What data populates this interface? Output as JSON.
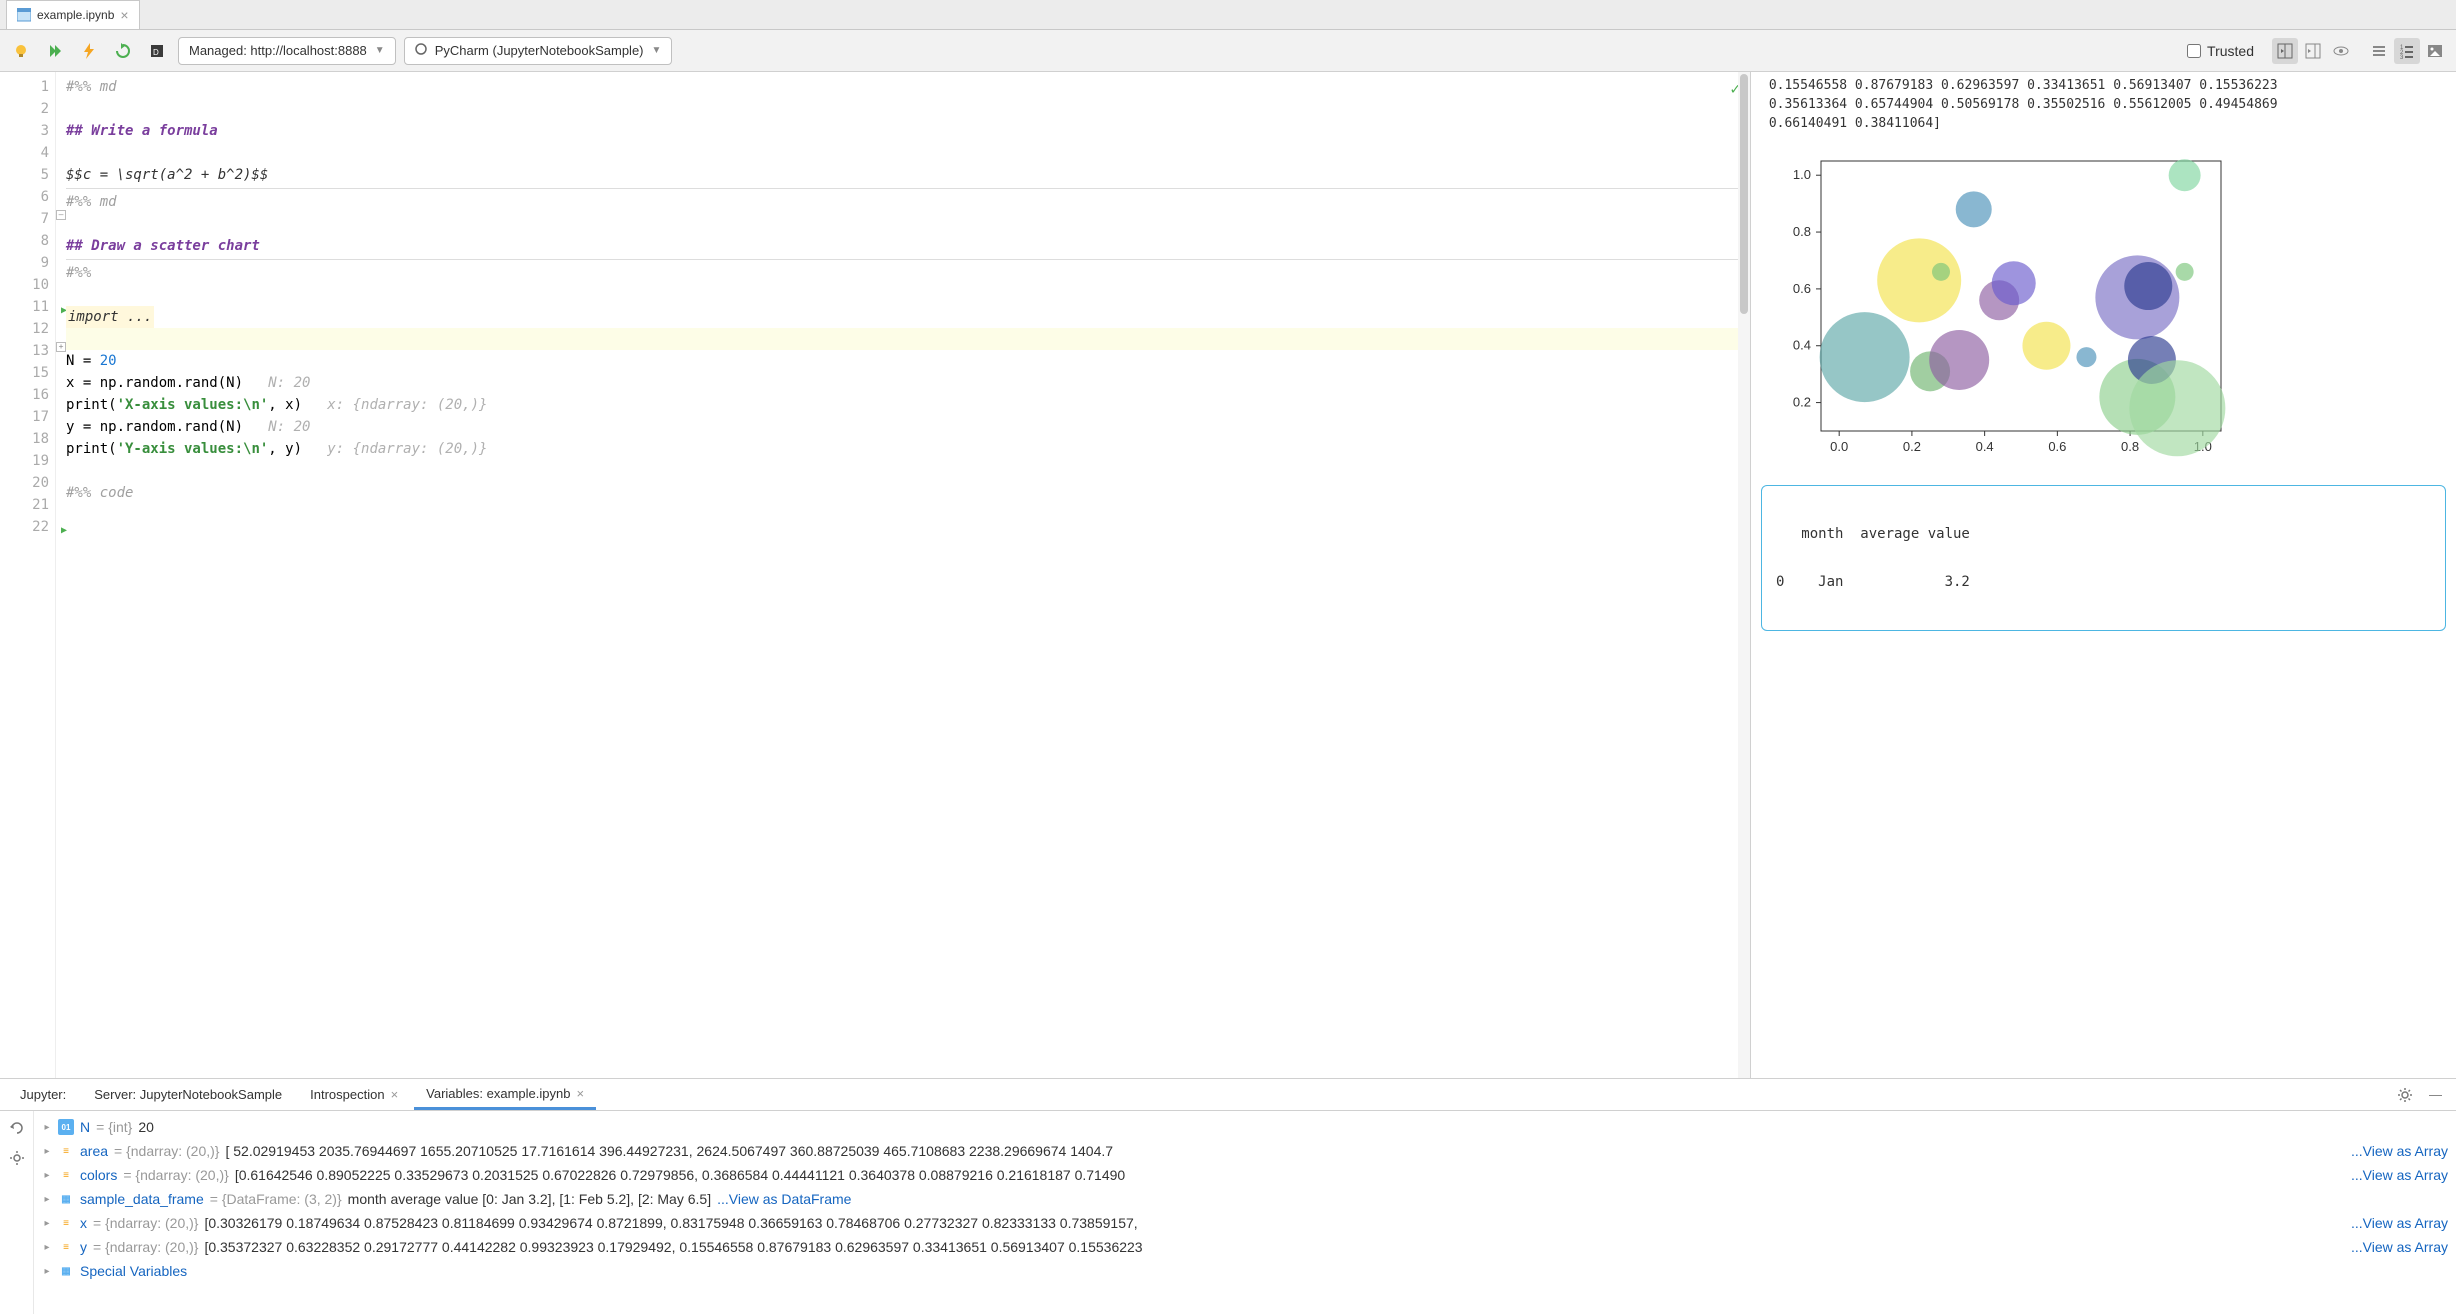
{
  "tab": {
    "filename": "example.ipynb"
  },
  "toolbar": {
    "server_dropdown": "Managed: http://localhost:8888",
    "kernel_dropdown": "PyCharm (JupyterNotebookSample)",
    "trusted_label": "Trusted",
    "trusted_checked": false
  },
  "editor": {
    "lines": [
      {
        "n": "1",
        "type": "comment",
        "text": "#%% md"
      },
      {
        "n": "2",
        "type": "blank",
        "text": ""
      },
      {
        "n": "3",
        "type": "heading",
        "text": "## Write a formula"
      },
      {
        "n": "4",
        "type": "blank",
        "text": ""
      },
      {
        "n": "5",
        "type": "raw",
        "text": "$$c = \\sqrt(a^2 + b^2)$$"
      },
      {
        "n": "6",
        "type": "hr",
        "text": ""
      },
      {
        "n": "7",
        "type": "comment",
        "text": "#%% md"
      },
      {
        "n": "8",
        "type": "blank",
        "text": ""
      },
      {
        "n": "9",
        "type": "heading",
        "text": "## Draw a scatter chart"
      },
      {
        "n": "10",
        "type": "hr",
        "text": ""
      },
      {
        "n": "11",
        "type": "comment",
        "text": "#%%",
        "run": true
      },
      {
        "n": "12",
        "type": "blank",
        "text": ""
      },
      {
        "n": "13",
        "type": "import",
        "text": "import ..."
      },
      {
        "n": "15",
        "type": "blank",
        "text": "",
        "highlight": true
      },
      {
        "n": "16",
        "type": "assign",
        "pre": "N = ",
        "num": "20"
      },
      {
        "n": "17",
        "type": "code_hint",
        "code": "x = np.random.rand(N)",
        "hint": "   N: 20"
      },
      {
        "n": "18",
        "type": "print",
        "pre": "print(",
        "str": "'X-axis values:\\n'",
        "post": ", x)",
        "hint": "   x: {ndarray: (20,)}"
      },
      {
        "n": "19",
        "type": "code_hint",
        "code": "y = np.random.rand(N)",
        "hint": "   N: 20"
      },
      {
        "n": "20",
        "type": "print",
        "pre": "print(",
        "str": "'Y-axis values:\\n'",
        "post": ", y)",
        "hint": "   y: {ndarray: (20,)}"
      },
      {
        "n": "21",
        "type": "blank",
        "text": ""
      },
      {
        "n": "22",
        "type": "comment",
        "text": "#%% code",
        "run": true
      }
    ]
  },
  "preview": {
    "stdout_lines": [
      " 0.15546558 0.87679183 0.62963597 0.33413651 0.56913407 0.15536223",
      " 0.35613364 0.65744904 0.50569178 0.35502516 0.55612005 0.49454869",
      " 0.66140491 0.38411064]"
    ],
    "dataframe_header": "   month  average value",
    "dataframe_row": "0    Jan            3.2"
  },
  "chart_data": {
    "type": "scatter",
    "xlim": [
      -0.05,
      1.05
    ],
    "ylim": [
      0.1,
      1.05
    ],
    "xticks": [
      0.0,
      0.2,
      0.4,
      0.6,
      0.8,
      1.0
    ],
    "yticks": [
      0.2,
      0.4,
      0.6,
      0.8,
      1.0
    ],
    "points": [
      {
        "x": 0.07,
        "y": 0.36,
        "r": 45,
        "c": "#5da7a7"
      },
      {
        "x": 0.22,
        "y": 0.63,
        "r": 42,
        "c": "#f2e24b"
      },
      {
        "x": 0.25,
        "y": 0.31,
        "r": 20,
        "c": "#6fb36f"
      },
      {
        "x": 0.28,
        "y": 0.66,
        "r": 9,
        "c": "#7ac47a"
      },
      {
        "x": 0.33,
        "y": 0.35,
        "r": 30,
        "c": "#8e5ea2"
      },
      {
        "x": 0.37,
        "y": 0.88,
        "r": 18,
        "c": "#4a90b8"
      },
      {
        "x": 0.44,
        "y": 0.56,
        "r": 20,
        "c": "#8e5ea2"
      },
      {
        "x": 0.48,
        "y": 0.62,
        "r": 22,
        "c": "#6a5acd"
      },
      {
        "x": 0.57,
        "y": 0.4,
        "r": 24,
        "c": "#f2e24b"
      },
      {
        "x": 0.68,
        "y": 0.36,
        "r": 10,
        "c": "#4a90b8"
      },
      {
        "x": 0.82,
        "y": 0.57,
        "r": 42,
        "c": "#7a6fc4"
      },
      {
        "x": 0.85,
        "y": 0.61,
        "r": 24,
        "c": "#2b3a8f"
      },
      {
        "x": 0.82,
        "y": 0.22,
        "r": 38,
        "c": "#8ed08e"
      },
      {
        "x": 0.86,
        "y": 0.35,
        "r": 24,
        "c": "#2b3a8f"
      },
      {
        "x": 0.93,
        "y": 0.18,
        "r": 48,
        "c": "#9fd89f"
      },
      {
        "x": 0.95,
        "y": 0.66,
        "r": 9,
        "c": "#7ac47a"
      },
      {
        "x": 0.95,
        "y": 1.0,
        "r": 16,
        "c": "#7fd6a0"
      }
    ]
  },
  "bottom": {
    "label_jupyter": "Jupyter:",
    "tab_server": "Server: JupyterNotebookSample",
    "tab_introspection": "Introspection",
    "tab_variables": "Variables: example.ipynb",
    "vars": [
      {
        "icon": "int",
        "name": "N",
        "type": " = {int} ",
        "val": "20",
        "link": ""
      },
      {
        "icon": "arr",
        "name": "area",
        "type": " = {ndarray: (20,)} ",
        "val": "[  52.02919453 2035.76944697 1655.20710525   17.7161614   396.44927231, 2624.5067497   360.88725039  465.7108683  2238.29669674 1404.7",
        "link": "...View as Array"
      },
      {
        "icon": "arr",
        "name": "colors",
        "type": " = {ndarray: (20,)} ",
        "val": "[0.61642546 0.89052225 0.33529673 0.2031525  0.67022826 0.72979856, 0.3686584  0.44441121 0.3640378  0.08879216 0.21618187 0.71490",
        "link": "...View as Array"
      },
      {
        "icon": "df",
        "name": "sample_data_frame",
        "type": " = {DataFrame: (3, 2)} ",
        "val": "month average value [0: Jan 3.2], [1: Feb 5.2], [2: May 6.5] ",
        "link": "...View as DataFrame",
        "inlineLink": true
      },
      {
        "icon": "arr",
        "name": "x",
        "type": " = {ndarray: (20,)} ",
        "val": "[0.30326179 0.18749634 0.87528423 0.81184699 0.93429674 0.8721899, 0.83175948 0.36659163 0.78468706 0.27732327 0.82333133 0.73859157, ",
        "link": "...View as Array"
      },
      {
        "icon": "arr",
        "name": "y",
        "type": " = {ndarray: (20,)} ",
        "val": "[0.35372327 0.63228352 0.29172777 0.44142282 0.99323923 0.17929492, 0.15546558 0.87679183 0.62963597 0.33413651 0.56913407 0.15536223",
        "link": "...View as Array"
      },
      {
        "icon": "df",
        "name": "Special Variables",
        "type": "",
        "val": "",
        "link": ""
      }
    ]
  }
}
